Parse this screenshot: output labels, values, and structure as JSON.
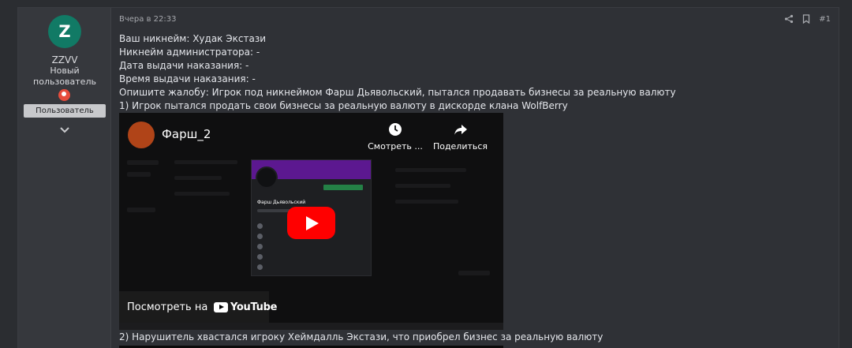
{
  "user": {
    "avatar_letter": "Z",
    "avatar_color": "#117a65",
    "name": "ZZVV",
    "title_line1": "Новый",
    "title_line2": "пользователь",
    "role": "Пользователь"
  },
  "post": {
    "date": "Вчера в 22:33",
    "number": "#1",
    "lines": [
      "Ваш никнейм: Худак Экстази",
      "Никнейм администратора: -",
      "Дата выдачи наказания: -",
      "Время выдачи наказания: -",
      "Опишите жалобу: Игрок под никнеймом Фарш Дьявольский, пытался продавать бизнесы за реальную валюту",
      "1) Игрок пытался продать свои бизнесы за реальную валюту в дискорде клана WolfBerry"
    ],
    "line_after_video": "2) Нарушитель хвастался игроку Хеймдалль Экстази, что приобрел бизнес за реальную валюту"
  },
  "video": {
    "title": "Фарш_2",
    "watch_later": "Смотреть ...",
    "share": "Поделиться",
    "watch_on": "Посмотреть на",
    "youtube": "YouTube",
    "discord_name": "Фарш Дьявольский",
    "accent": "#ff0000"
  },
  "icons": {
    "share": "share-icon",
    "bookmark": "bookmark-icon",
    "expand": "chevron-down-icon",
    "badge": "user-badge-icon"
  }
}
